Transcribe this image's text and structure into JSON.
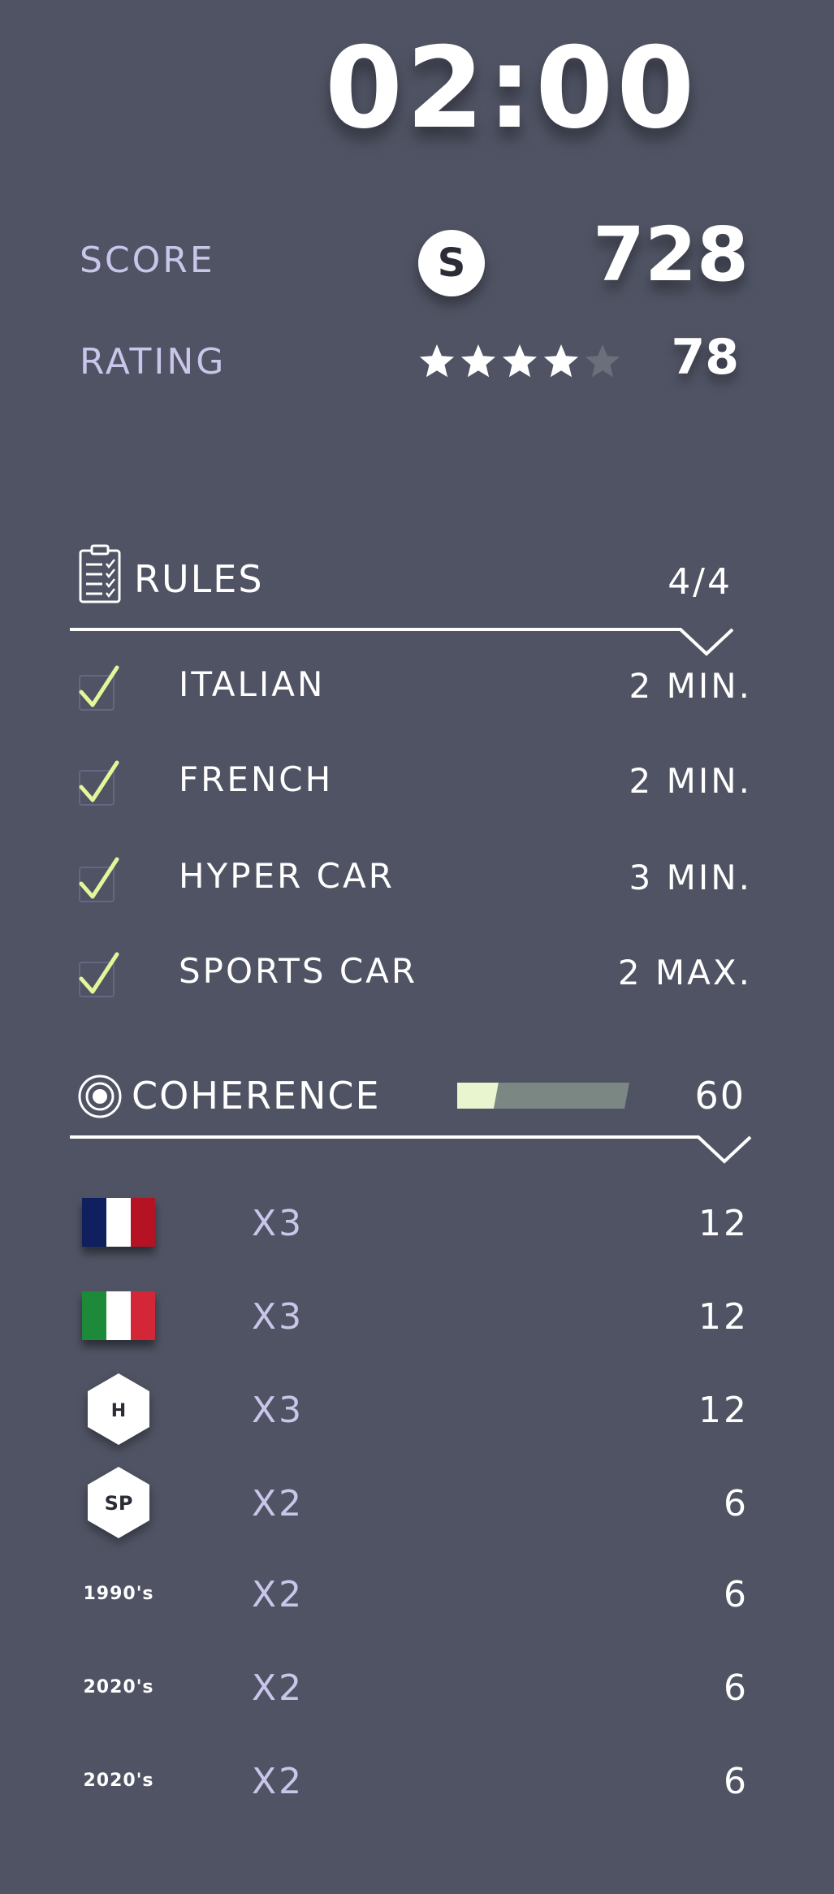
{
  "timer": "02:00",
  "score": {
    "label": "SCORE",
    "badge_letter": "S",
    "value": "728"
  },
  "rating": {
    "label": "RATING",
    "stars_filled": 4,
    "stars_total": 5,
    "value": "78"
  },
  "rules": {
    "title": "RULES",
    "count": "4/4",
    "icon": "clipboard-checklist-icon",
    "items": [
      {
        "label": "ITALIAN",
        "value": "2 MIN.",
        "checked": true
      },
      {
        "label": "FRENCH",
        "value": "2 MIN.",
        "checked": true
      },
      {
        "label": "HYPER CAR",
        "value": "3 MIN.",
        "checked": true
      },
      {
        "label": "SPORTS CAR",
        "value": "2 MAX.",
        "checked": true
      }
    ]
  },
  "coherence": {
    "title": "COHERENCE",
    "icon": "target-icon",
    "value": "60",
    "progress_fraction": 0.24,
    "items": [
      {
        "icon": "france-flag-icon",
        "multiplier": "X3",
        "value": "12"
      },
      {
        "icon": "italy-flag-icon",
        "multiplier": "X3",
        "value": "12"
      },
      {
        "icon": "hyper-car-hex-icon",
        "badge": "H",
        "multiplier": "X3",
        "value": "12"
      },
      {
        "icon": "sports-car-hex-icon",
        "badge": "SP",
        "multiplier": "X2",
        "value": "6"
      },
      {
        "era": "1990's",
        "multiplier": "X2",
        "value": "6"
      },
      {
        "era": "2020's",
        "multiplier": "X2",
        "value": "6"
      },
      {
        "era": "2020's",
        "multiplier": "X2",
        "value": "6"
      }
    ]
  },
  "colors": {
    "background": "#4f5363",
    "label": "#c9c6ea",
    "check": "#e4f59a",
    "bar_fill": "#e9f5cf",
    "bar_track": "#7b8782",
    "star_empty": "#6b6f7c"
  }
}
